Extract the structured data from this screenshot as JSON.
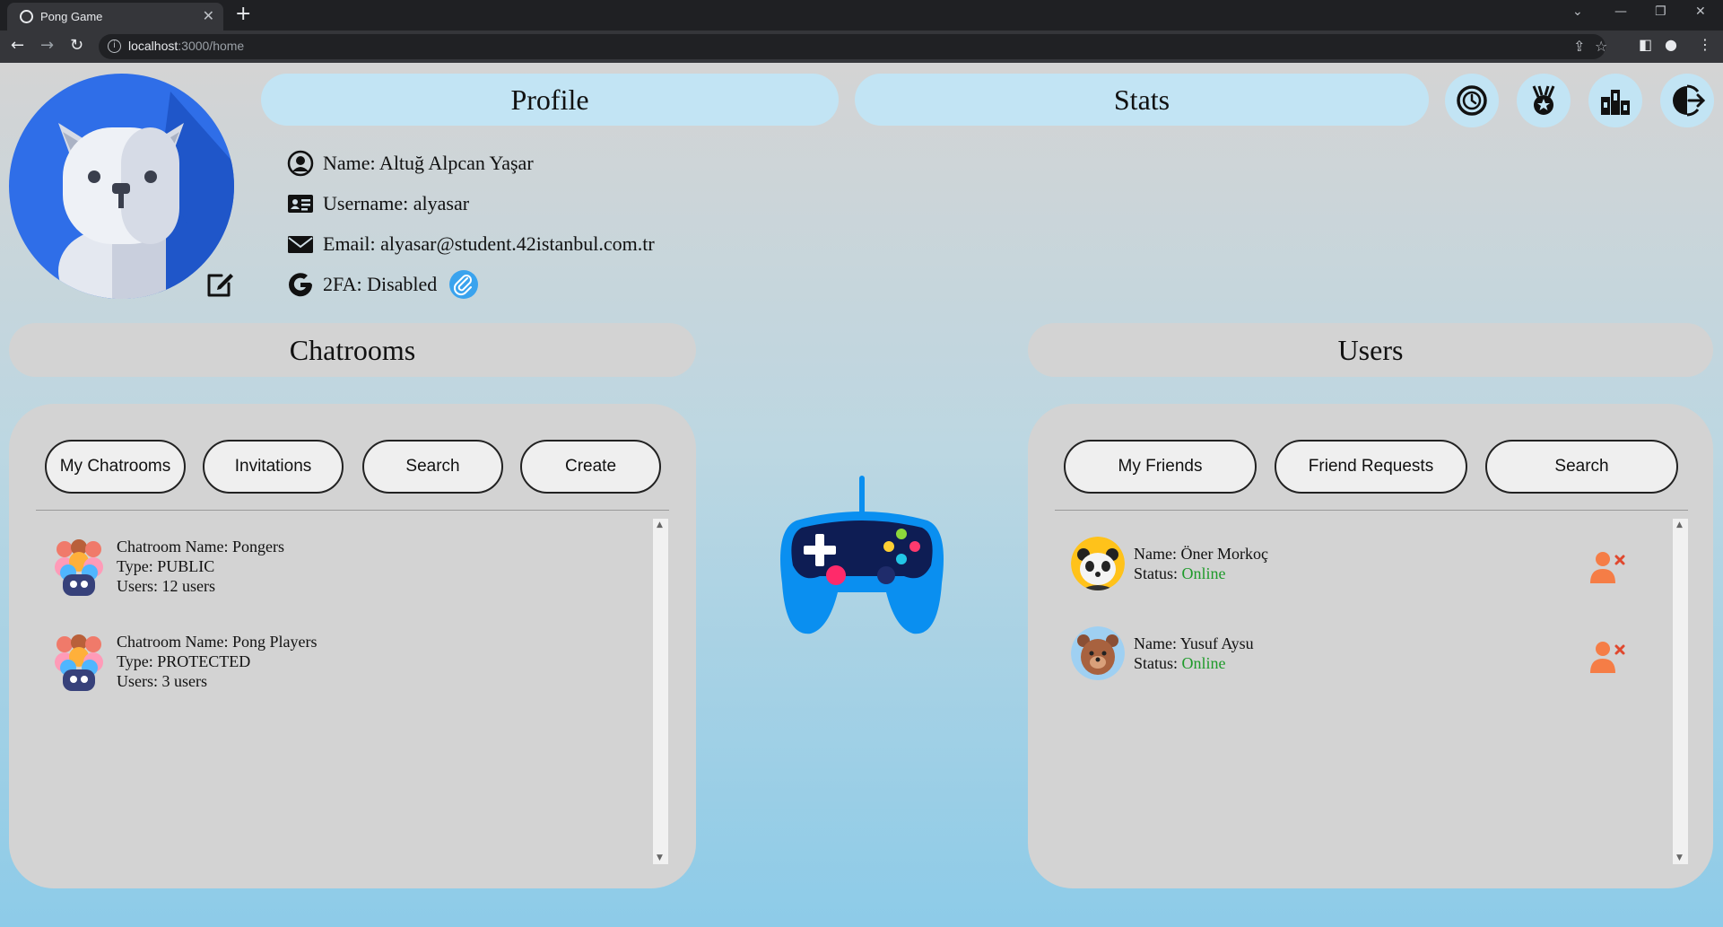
{
  "browser": {
    "tab_title": "Pong Game",
    "url_host": "localhost",
    "url_rest": ":3000/home"
  },
  "header": {
    "profile_label": "Profile",
    "stats_label": "Stats",
    "icon_buttons": [
      "history-icon",
      "achievements-icon",
      "leaderboard-icon",
      "logout-icon"
    ]
  },
  "profile": {
    "name": "Name: Altuğ Alpcan Yaşar",
    "username": "Username: alyasar",
    "email": "Email: alyasar@student.42istanbul.com.tr",
    "twofa": "2FA: Disabled"
  },
  "chatrooms": {
    "title": "Chatrooms",
    "tabs": [
      "My Chatrooms",
      "Invitations",
      "Search",
      "Create"
    ],
    "items": [
      {
        "name": "Chatroom Name: Pongers",
        "type": "Type: PUBLIC",
        "users": "Users: 12 users"
      },
      {
        "name": "Chatroom Name: Pong Players",
        "type": "Type: PROTECTED",
        "users": "Users: 3 users"
      }
    ]
  },
  "users": {
    "title": "Users",
    "tabs": [
      "My Friends",
      "Friend Requests",
      "Search"
    ],
    "items": [
      {
        "name": "Name: Öner Morkoç",
        "status_label": "Status: ",
        "status": "Online"
      },
      {
        "name": "Name: Yusuf Aysu",
        "status_label": "Status: ",
        "status": "Online"
      }
    ]
  },
  "colors": {
    "pill_blue": "#c2e4f4",
    "panel_gray": "#d3d3d3",
    "online_green": "#1e9a2a",
    "avatar_blue": "#2f6ee8"
  }
}
